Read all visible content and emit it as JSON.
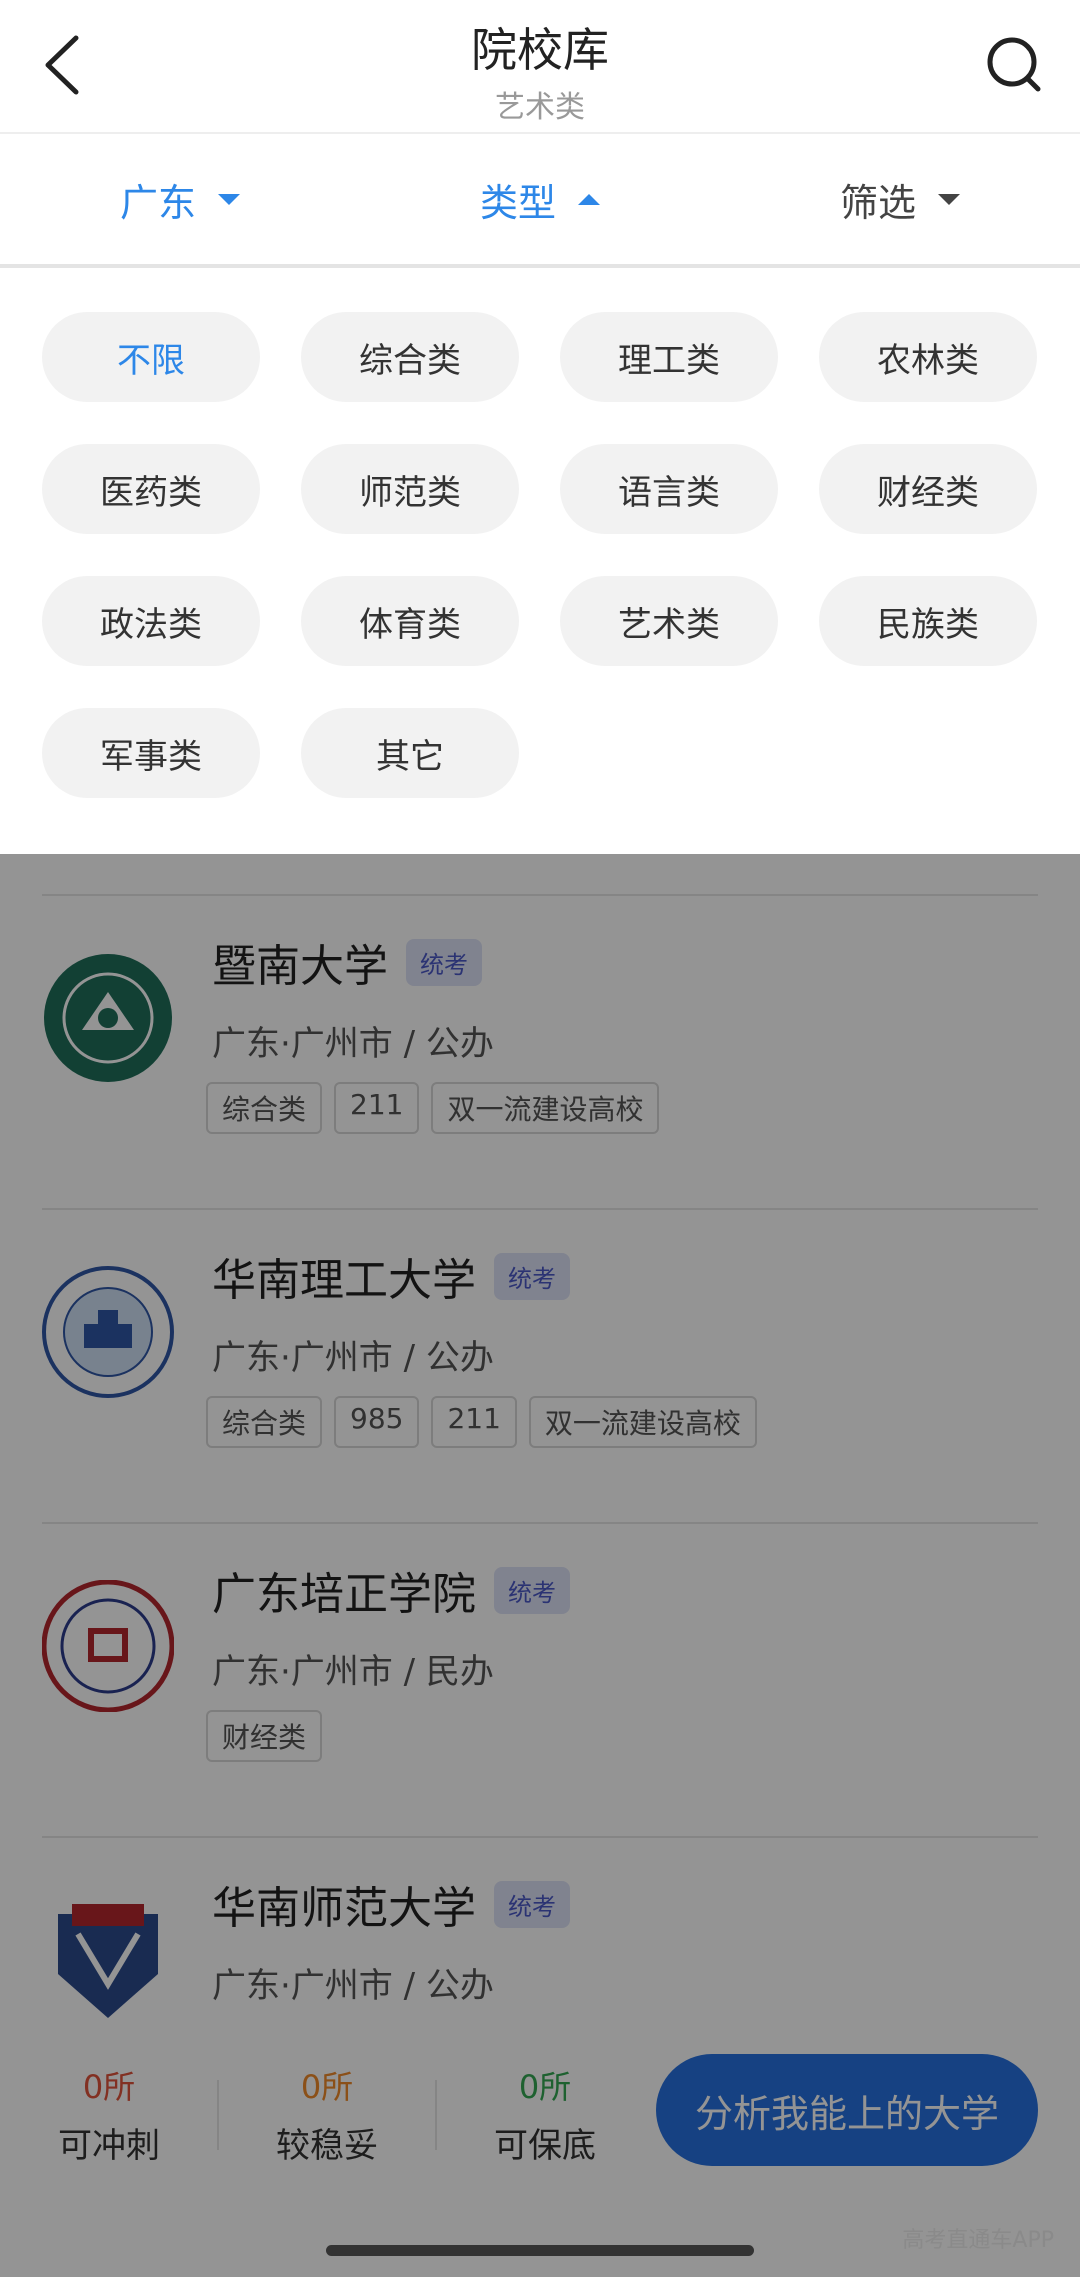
{
  "header": {
    "title": "院校库",
    "subtitle": "艺术类"
  },
  "filters": [
    {
      "label": "广东",
      "state": "down",
      "color": "#2d87e8"
    },
    {
      "label": "类型",
      "state": "up",
      "color": "#2d87e8"
    },
    {
      "label": "筛选",
      "state": "down",
      "color": "#444444"
    }
  ],
  "type_options": [
    "不限",
    "综合类",
    "理工类",
    "农林类",
    "医药类",
    "师范类",
    "语言类",
    "财经类",
    "政法类",
    "体育类",
    "艺术类",
    "民族类",
    "军事类",
    "其它"
  ],
  "universities": [
    {
      "name": "暨南大学",
      "badge": "统考",
      "location": "广东·广州市 / 公办",
      "tags": [
        "综合类",
        "211",
        "双一流建设高校"
      ],
      "logo_color": "#1f6e5a"
    },
    {
      "name": "华南理工大学",
      "badge": "统考",
      "location": "广东·广州市 / 公办",
      "tags": [
        "综合类",
        "985",
        "211",
        "双一流建设高校"
      ],
      "logo_color": "#2f56a6"
    },
    {
      "name": "广东培正学院",
      "badge": "统考",
      "location": "广东·广州市 / 民办",
      "tags": [
        "财经类"
      ],
      "logo_color": "#b3262d"
    },
    {
      "name": "华南师范大学",
      "badge": "统考",
      "location": "广东·广州市 / 公办",
      "tags": [],
      "logo_color": "#2c4a8c"
    }
  ],
  "bottom": {
    "stats": [
      {
        "num": "0所",
        "label": "可冲刺",
        "color": "#e0533b"
      },
      {
        "num": "0所",
        "label": "较稳妥",
        "color": "#f08a2a"
      },
      {
        "num": "0所",
        "label": "可保底",
        "color": "#35a854"
      }
    ],
    "analyze_label": "分析我能上的大学"
  },
  "watermark": "高考直通车APP"
}
